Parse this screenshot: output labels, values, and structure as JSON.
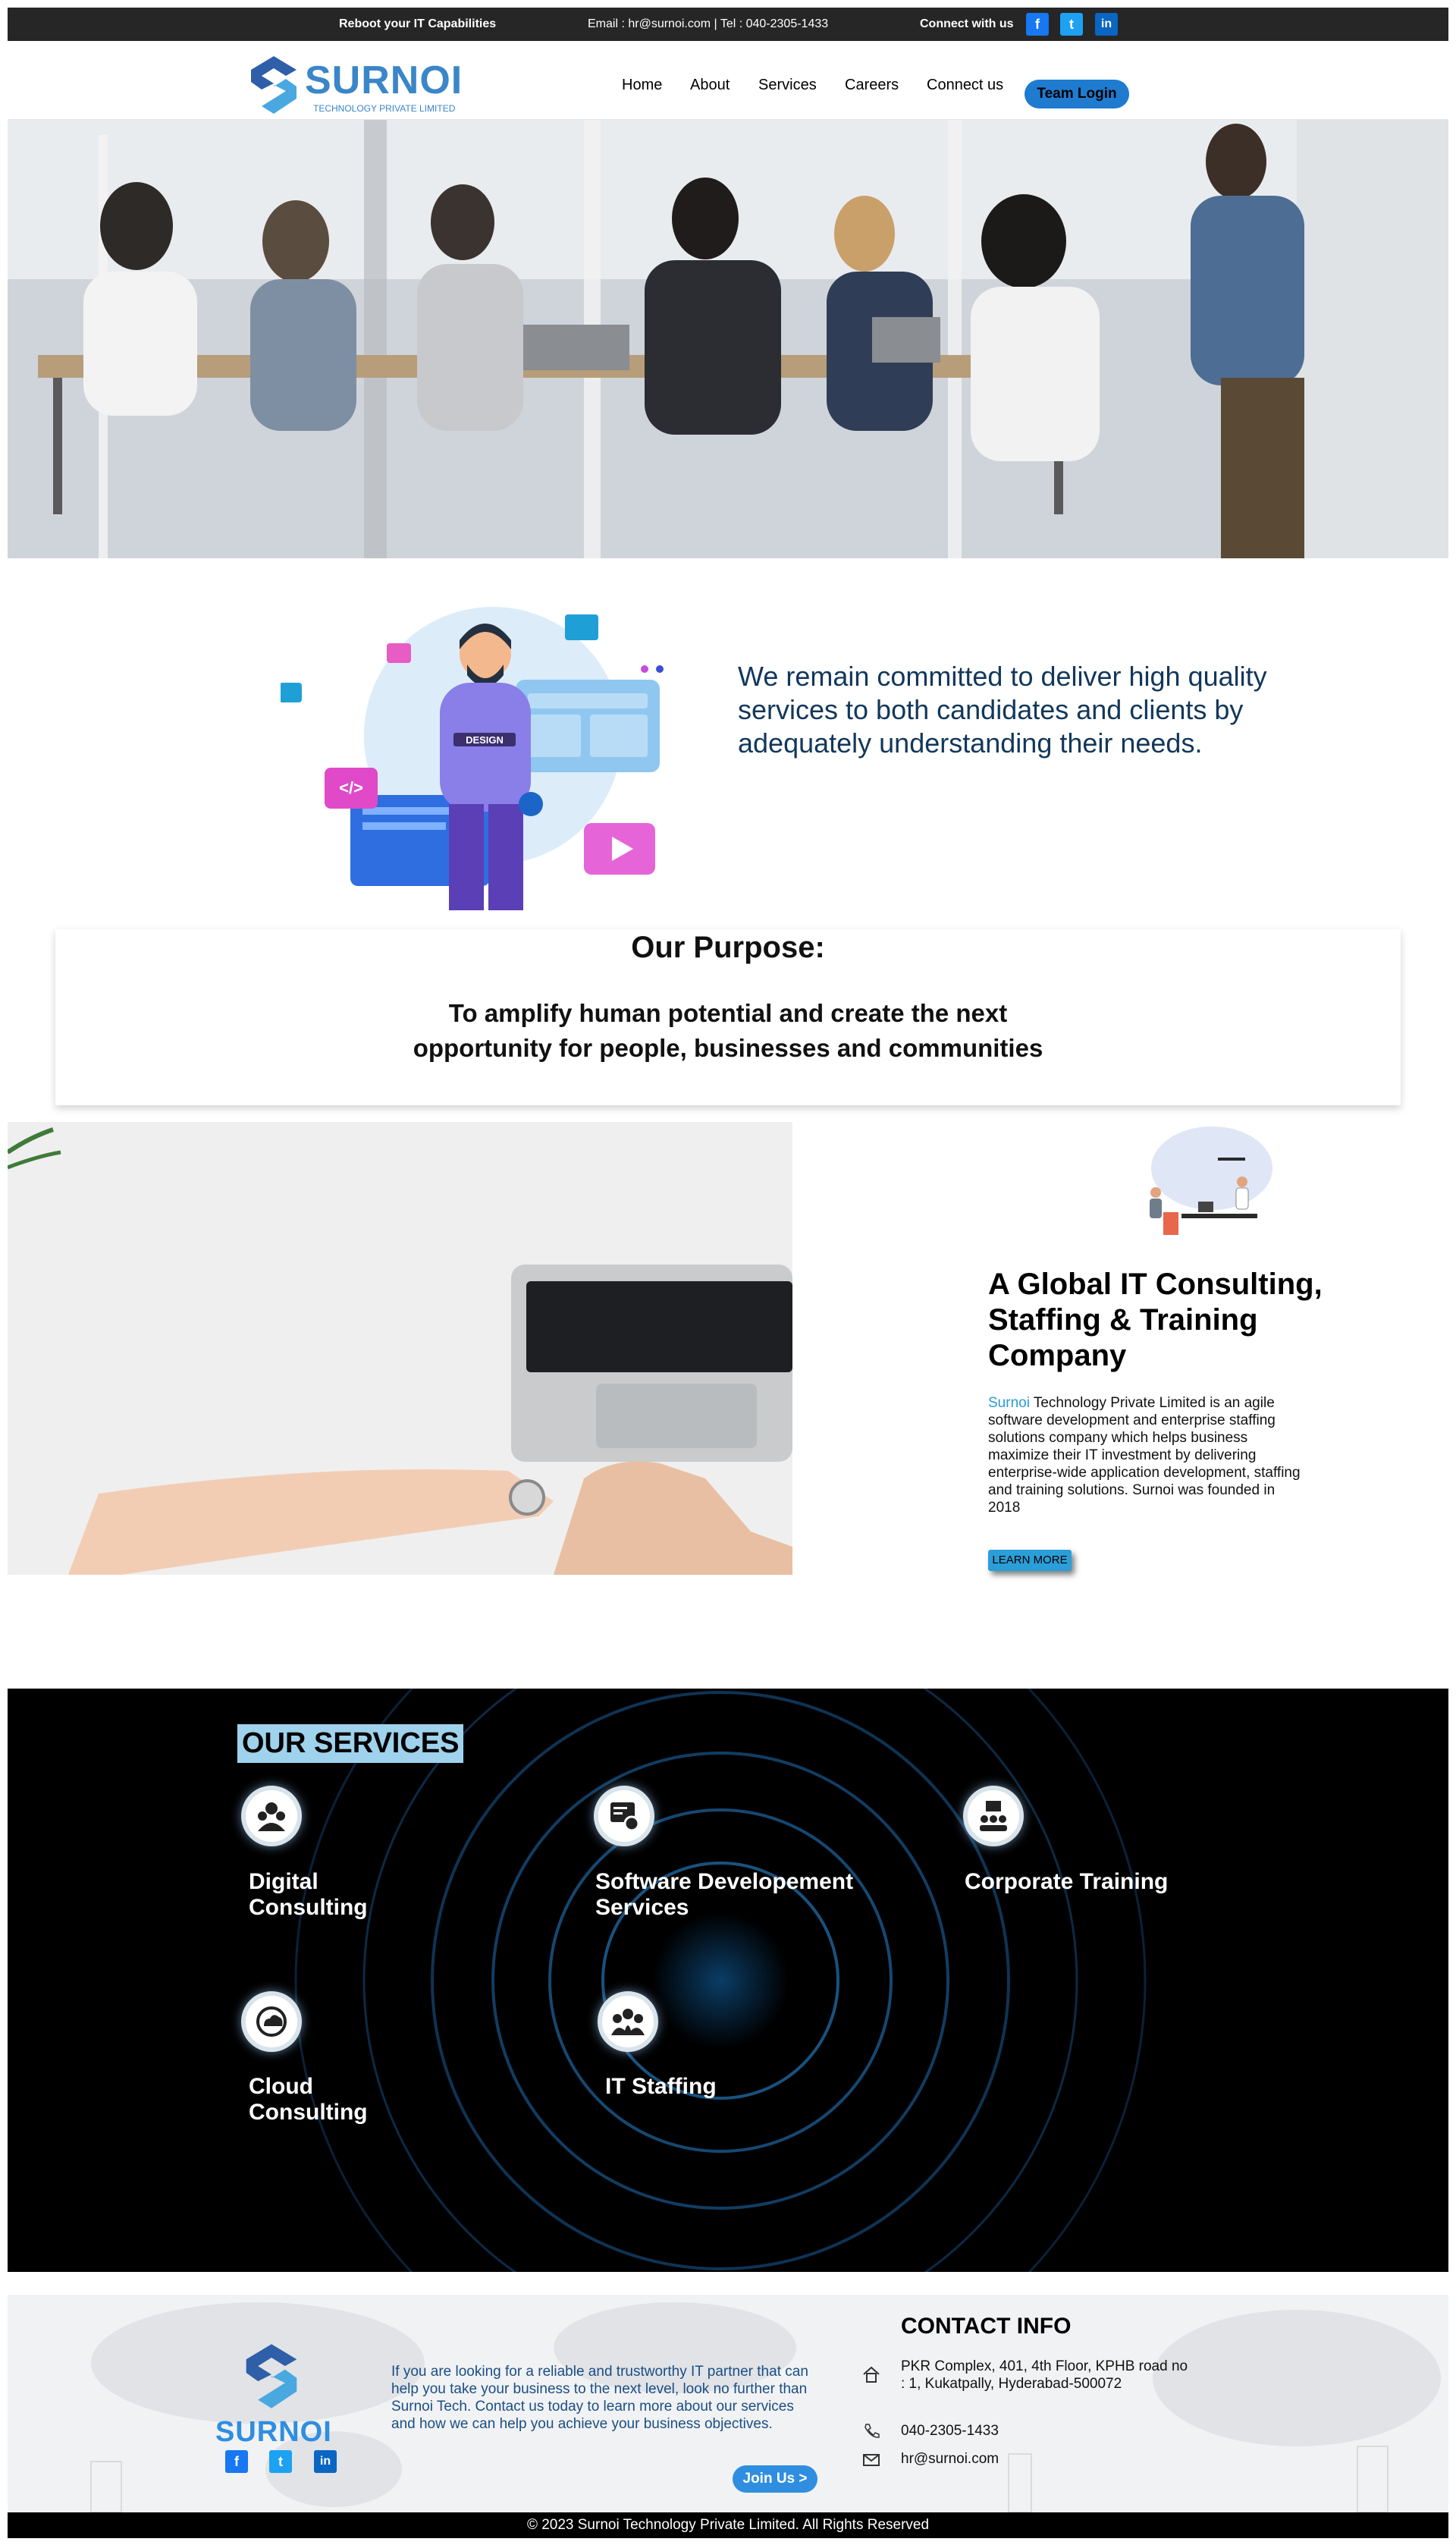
{
  "topbar": {
    "tagline": "Reboot your IT Capabilities",
    "contact": "Email : hr@surnoi.com | Tel : 040-2305-1433",
    "connect_label": "Connect with us",
    "social": [
      "facebook-icon",
      "twitter-icon",
      "linkedin-icon"
    ]
  },
  "header": {
    "logo_text": "SURNOI",
    "logo_subtitle": "TECHNOLOGY PRIVATE LIMITED",
    "nav": [
      "Home",
      "About",
      "Services",
      "Careers",
      "Connect us"
    ],
    "team_login": "Team Login"
  },
  "commitment": {
    "text": "We remain committed to deliver high quality services to both candidates and clients by adequately understanding their needs."
  },
  "purpose": {
    "title": "Our Purpose:",
    "body": "To amplify human potential and create the next opportunity for people, businesses and communities"
  },
  "about": {
    "heading": "A Global IT Consulting, Staffing & Training Company",
    "brand": "Surnoi",
    "body": " Technology Private Limited is an agile software development and enterprise staffing solutions company which helps business maximize their IT investment by delivering enterprise-wide application development, staffing and training solutions. Surnoi was founded in 2018",
    "learn_more": "LEARN MORE"
  },
  "services": {
    "title": "OUR SERVICES",
    "items": [
      {
        "label": "Digital Consulting",
        "icon": "consulting-icon"
      },
      {
        "label": "Software Developement Services",
        "icon": "software-icon"
      },
      {
        "label": "Corporate Training",
        "icon": "training-icon"
      },
      {
        "label": "Cloud Consulting",
        "icon": "cloud-icon"
      },
      {
        "label": "IT Staffing",
        "icon": "staffing-icon"
      }
    ]
  },
  "footer": {
    "logo_text": "SURNOI",
    "blurb": "If you are looking for a reliable and trustworthy IT partner that can help you take your business to the next level, look no further than Surnoi Tech. Contact us today to learn more about our services and how we can help you achieve your business objectives.",
    "join_us": "Join Us >",
    "contact_title": "CONTACT INFO",
    "address": "PKR Complex, 401, 4th Floor, KPHB road no : 1, Kukatpally, Hyderabad-500072",
    "phone": "040-2305-1433",
    "email": "hr@surnoi.com",
    "copyright": "© 2023 Surnoi Technology Private Limited. All Rights Reserved"
  },
  "colors": {
    "topbar_bg": "#262626",
    "brand_blue": "#3a86c8",
    "commit_text": "#12375b",
    "services_bg": "#000000",
    "services_title_bg": "#9fd2ec",
    "footer_bg": "#f1f2f3"
  }
}
